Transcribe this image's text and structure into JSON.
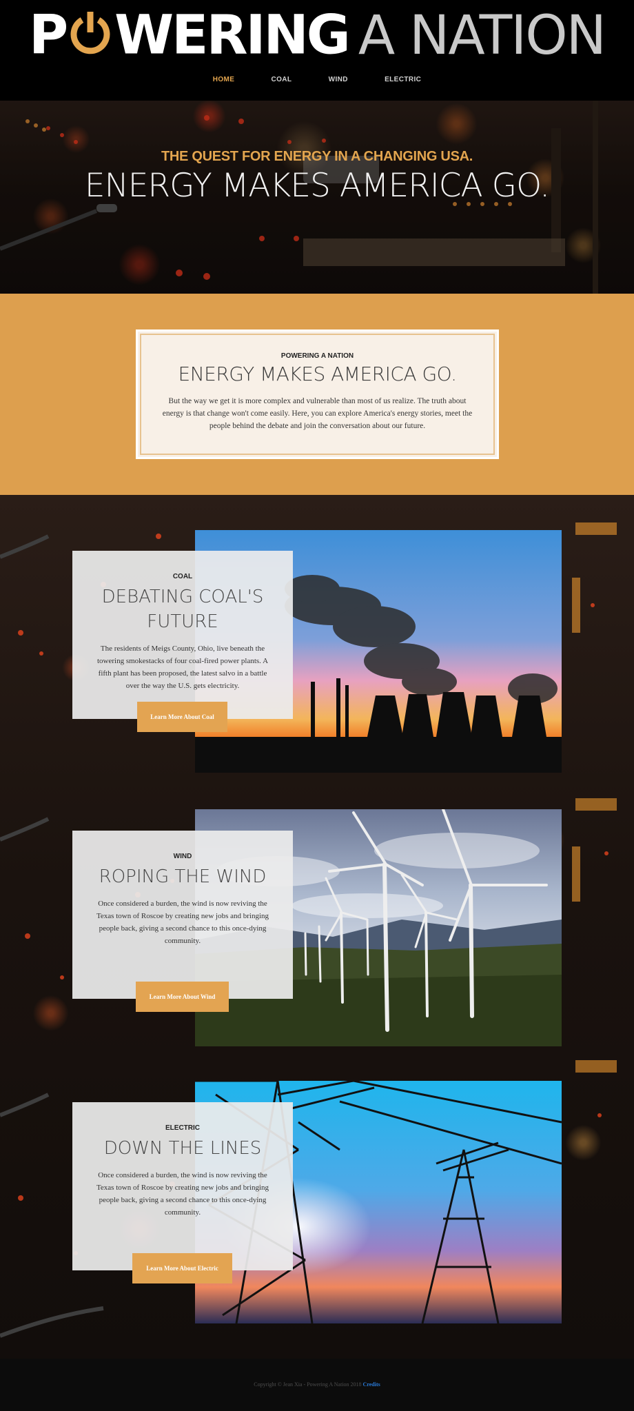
{
  "logo": {
    "text_strong_1": "P",
    "text_strong_2": "WERING",
    "text_light": "A NATION",
    "power_icon": "power-button-icon",
    "accent_color": "#e3a54f"
  },
  "nav": {
    "items": [
      {
        "label": "HOME",
        "active": true
      },
      {
        "label": "COAL",
        "active": false
      },
      {
        "label": "WIND",
        "active": false
      },
      {
        "label": "ELECTRIC",
        "active": false
      }
    ]
  },
  "hero": {
    "kicker": "THE QUEST FOR ENERGY IN A CHANGING USA.",
    "title": "ENERGY MAKES AMERICA GO."
  },
  "intro": {
    "kicker": "POWERING A NATION",
    "title": "ENERGY MAKES AMERICA GO.",
    "body": "But the way we get it is more complex and vulnerable than most of us realize. The truth about energy is that change won't come easily. Here, you can explore America's energy stories, meet the people behind the debate and join the conversation about our future."
  },
  "features": [
    {
      "kicker": "COAL",
      "title": "DEBATING COAL'S FUTURE",
      "body": "The residents of Meigs County, Ohio, live beneath the towering smokestacks of four coal-fired power plants. A fifth plant has been proposed, the latest salvo in a battle over the way the U.S. gets electricity.",
      "button": "Learn More About Coal",
      "image": "coal-power-plant-sunset"
    },
    {
      "kicker": "WIND",
      "title": "ROPING THE WIND",
      "body": "Once considered a burden, the wind is now reviving the Texas town of Roscoe by creating new jobs and bringing people back, giving a second chance to this once-dying community.",
      "button": "Learn More About Wind",
      "image": "wind-turbines-hills"
    },
    {
      "kicker": "ELECTRIC",
      "title": "DOWN THE LINES",
      "body": "Once considered a burden, the wind is now reviving the Texas town of Roscoe by creating new jobs and bringing people back, giving a second chance to this once-dying community.",
      "button": "Learn More About Electric",
      "image": "power-line-towers-sky"
    }
  ],
  "footer": {
    "text": "Copyright © Jean Xia - Powering A Nation 2018",
    "link": "Credits"
  }
}
